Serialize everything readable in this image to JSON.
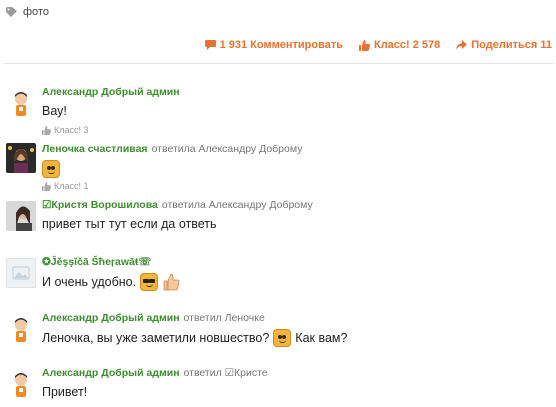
{
  "topic": {
    "tag": "фото"
  },
  "actions": {
    "comments": "1 931 Комментировать",
    "likes": "Класс! 2 578",
    "share": "Поделиться 11"
  },
  "colors": {
    "accent": "#eb722e",
    "author": "#3d8f2e",
    "muted": "#777777"
  },
  "comments": [
    {
      "author": "Александр Добрый админ",
      "replyto": "",
      "text": "Вау!",
      "like": "Класс! 3",
      "avatar": "boy-avatar"
    },
    {
      "author": "Леночка счастливая",
      "replyto": "ответила Александру Доброму",
      "text": "",
      "emoji": "smile-emoji",
      "like": "Класс! 1",
      "avatar": "photo-avatar-dark"
    },
    {
      "author": "☑Кристя Ворошилова",
      "replyto": "ответила Александру Доброму",
      "text": "привет тыт тут если да ответь",
      "like": "",
      "avatar": "photo-avatar-girl"
    },
    {
      "author": "✪Ĵĕşşĭčā Šħeŗawāŧ☏",
      "replyto": "",
      "text": "И очень удобно.",
      "emoji": "sunglasses-emoji",
      "like": "",
      "avatar": "placeholder-avatar"
    },
    {
      "author": "Александр Добрый админ",
      "replyto": "ответил Леночке",
      "text": "Леночка, вы уже заметили новшество?",
      "text_after": "Как вам?",
      "like": "",
      "avatar": "boy-avatar"
    },
    {
      "author": "Александр Добрый админ",
      "replyto": "ответил ☑Кристе",
      "text": "Привет!",
      "like": "",
      "avatar": "boy-avatar"
    }
  ]
}
